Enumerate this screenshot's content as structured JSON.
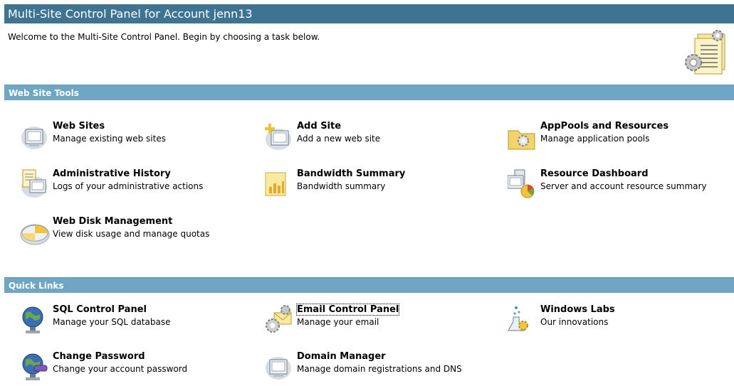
{
  "header": {
    "title": "Multi-Site Control Panel for Account jenn13",
    "welcome": "Welcome to the Multi-Site Control Panel. Begin by choosing a task below."
  },
  "web_site_tools": {
    "heading": "Web Site Tools",
    "items": [
      {
        "name": "Web Sites",
        "desc": "Manage existing web sites",
        "icon": "monitor-icon"
      },
      {
        "name": "Add Site",
        "desc": "Add a new web site",
        "icon": "add-site-icon"
      },
      {
        "name": "AppPools and Resources",
        "desc": "Manage application pools",
        "icon": "folder-gear-icon"
      },
      {
        "name": "Administrative History",
        "desc": "Logs of your administrative actions",
        "icon": "history-log-icon"
      },
      {
        "name": "Bandwidth Summary",
        "desc": "Bandwidth summary",
        "icon": "bar-chart-icon"
      },
      {
        "name": "Resource Dashboard",
        "desc": "Server and account resource summary",
        "icon": "dashboard-icon"
      },
      {
        "name": "Web Disk Management",
        "desc": "View disk usage and manage quotas",
        "icon": "disk-icon"
      }
    ]
  },
  "quick_links": {
    "heading": "Quick Links",
    "items": [
      {
        "name": "SQL Control Panel",
        "desc": "Manage your SQL database",
        "icon": "globe-database-icon"
      },
      {
        "name": "Email Control Panel",
        "desc": "Manage your email",
        "icon": "email-gear-icon"
      },
      {
        "name": "Windows Labs",
        "desc": "Our innovations",
        "icon": "flask-icon"
      },
      {
        "name": "Change Password",
        "desc": "Change your account password",
        "icon": "globe-key-icon"
      },
      {
        "name": "Domain Manager",
        "desc": "Manage domain registrations and DNS",
        "icon": "monitor-icon"
      }
    ]
  }
}
